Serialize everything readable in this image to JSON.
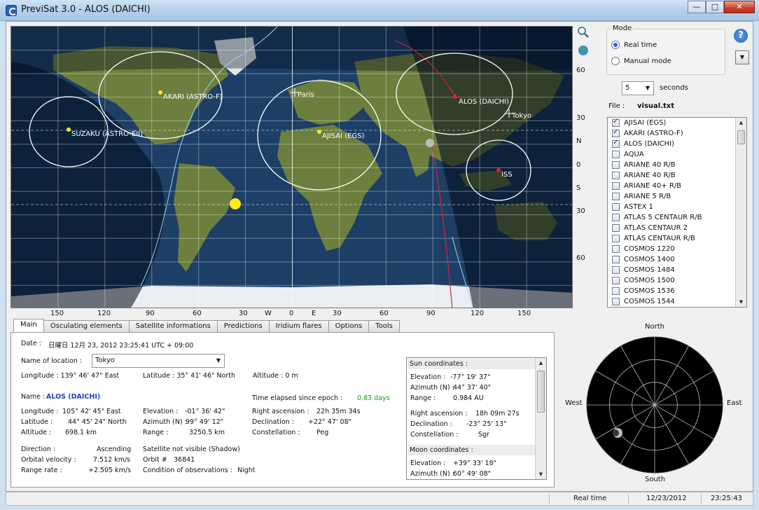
{
  "window": {
    "title": "PreviSat 3.0 - ALOS (DAICHI)",
    "buttons": {
      "minimize": "—",
      "maximize": "□",
      "close": "✕"
    }
  },
  "map": {
    "lat_labels": [
      "60",
      "30",
      "N",
      "0",
      "S",
      "30",
      "60"
    ],
    "lon_labels": [
      "150",
      "120",
      "90",
      "60",
      "30",
      "W",
      "0",
      "E",
      "30",
      "60",
      "90",
      "120",
      "150"
    ],
    "satellites": [
      {
        "name": "AKARI (ASTRO-F)"
      },
      {
        "name": "SUZAKU (ASTRO-EII)"
      },
      {
        "name": "AJISAI (EGS)"
      },
      {
        "name": "ALOS (DAICHI)"
      },
      {
        "name": "ISS"
      }
    ],
    "locations": [
      "Paris",
      "Tokyo"
    ],
    "colors": {
      "ocean": "#1d3f66",
      "land": "#6d7f3e",
      "night": "#000a18",
      "ice": "#e8eef2",
      "selected_track": "#e0203a",
      "sun": "#ffe81a"
    },
    "icons": {
      "zoom": "zoom-icon",
      "globe": "globe-icon"
    }
  },
  "mode": {
    "title": "Mode",
    "options": [
      "Real time",
      "Manual mode"
    ],
    "selected": "Real time"
  },
  "step": {
    "value": "5",
    "unit": "seconds"
  },
  "file": {
    "label": "File :",
    "name": "visual.txt"
  },
  "satellite_list": [
    {
      "name": "AJISAI (EGS)",
      "checked": true
    },
    {
      "name": "AKARI (ASTRO-F)",
      "checked": true
    },
    {
      "name": "ALOS (DAICHI)",
      "checked": true
    },
    {
      "name": "AQUA",
      "checked": false
    },
    {
      "name": "ARIANE 40 R/B",
      "checked": false
    },
    {
      "name": "ARIANE 40 R/B",
      "checked": false
    },
    {
      "name": "ARIANE 40+ R/B",
      "checked": false
    },
    {
      "name": "ARIANE 5 R/B",
      "checked": false
    },
    {
      "name": "ASTEX 1",
      "checked": false
    },
    {
      "name": "ATLAS 5 CENTAUR R/B",
      "checked": false
    },
    {
      "name": "ATLAS CENTAUR 2",
      "checked": false
    },
    {
      "name": "ATLAS CENTAUR R/B",
      "checked": false
    },
    {
      "name": "COSMOS 1220",
      "checked": false
    },
    {
      "name": "COSMOS 1400",
      "checked": false
    },
    {
      "name": "COSMOS 1484",
      "checked": false
    },
    {
      "name": "COSMOS 1500",
      "checked": false
    },
    {
      "name": "COSMOS 1536",
      "checked": false
    },
    {
      "name": "COSMOS 1544",
      "checked": false
    }
  ],
  "tabs": [
    "Main",
    "Osculating elements",
    "Satellite informations",
    "Predictions",
    "Iridium flares",
    "Options",
    "Tools"
  ],
  "main": {
    "date_label": "Date :",
    "date_value": "日曜日 12月 23, 2012  23:25:41  UTC + 09:00",
    "location_label": "Name of location :",
    "location_value": "Tokyo",
    "obs_longitude": "Longitude :  139°  46' 47\" East",
    "obs_latitude": "Latitude :   35°  41' 46\" North",
    "obs_altitude": "Altitude :   0 m",
    "name_label": "Name :",
    "name_value": "ALOS (DAICHI)",
    "epoch_label": "Time elapsed since epoch :",
    "epoch_value": "0.83 days",
    "sat_lon_label": "Longitude :",
    "sat_lon": "105°  42' 45\" East",
    "sat_lat_label": "Latitude :",
    "sat_lat": "44°  45' 24\" North",
    "sat_alt_label": "Altitude :",
    "sat_alt": "698.1 km",
    "elev_label": "Elevation :",
    "elev": "-01°  36' 42\"",
    "azim_label": "Azimuth (N) :",
    "azim": "99°  49' 12\"",
    "range_label": "Range :",
    "range": "3250.5 km",
    "ra_label": "Right ascension :",
    "ra": "22h 35m 34s",
    "dec_label": "Declination :",
    "dec": "+22°  47' 08\"",
    "const_label": "Constellation :",
    "const": "Peg",
    "dir_label": "Direction :",
    "dir": "Ascending",
    "vel_label": "Orbital velocity :",
    "vel": "7.512 km/s",
    "rate_label": "Range rate :",
    "rate": "+2.505 km/s",
    "visibility": "Satellite not visible (Shadow)",
    "orbit_label": "Orbit #",
    "orbit": "36841",
    "cond_label": "Condition of observations :",
    "cond": "Night"
  },
  "sun": {
    "title": "Sun coordinates :",
    "elev_label": "Elevation :",
    "elev": "-77°  19' 37\"",
    "azim_label": "Azimuth (N) :",
    "azim": "44°  37' 40\"",
    "range_label": "Range :",
    "range": "0.984 AU",
    "ra_label": "Right ascension :",
    "ra": "18h 09m 27s",
    "dec_label": "Declination :",
    "dec": "-23°  25' 13\"",
    "const_label": "Constellation :",
    "const": "Sgr"
  },
  "moon": {
    "title": "Moon coordinates :",
    "elev_label": "Elevation :",
    "elev": "+39°  33' 18\"",
    "azim_label": "Azimuth (N) :",
    "azim": "60°  49' 08\""
  },
  "sky": {
    "north": "North",
    "south": "South",
    "east": "East",
    "west": "West"
  },
  "status": {
    "mode": "Real time",
    "date": "12/23/2012",
    "time": "23:25:43"
  }
}
